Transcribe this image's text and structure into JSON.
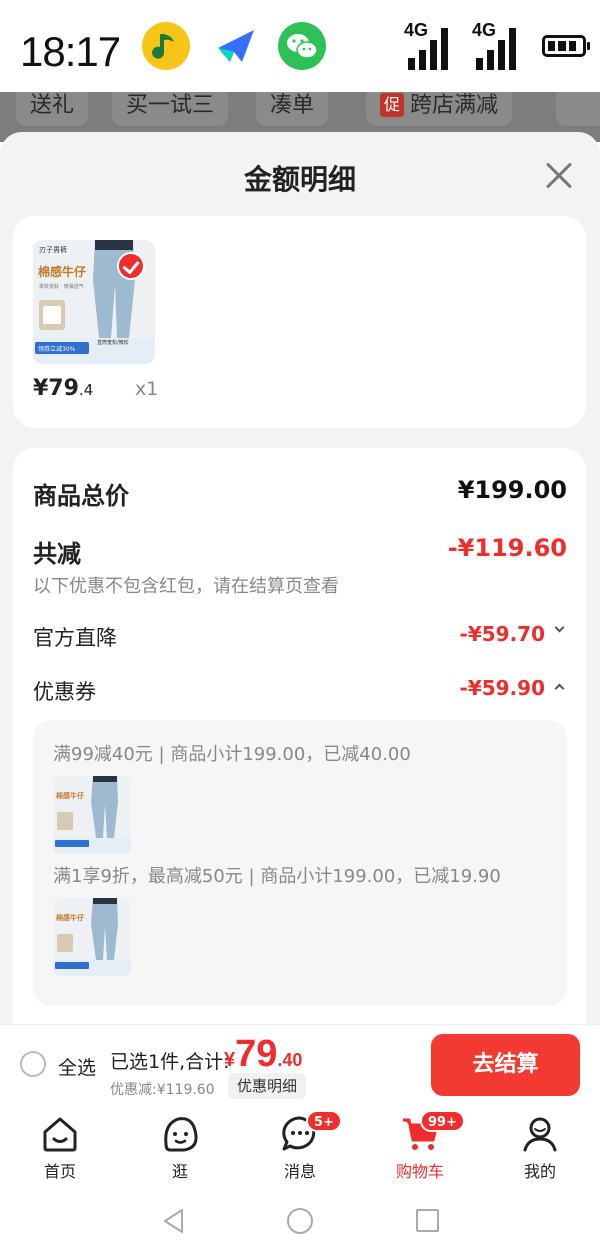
{
  "status_bar": {
    "time": "18:17",
    "network_1": "4G",
    "network_2": "4G",
    "app_icons": [
      "qq-music-icon",
      "feishu-icon",
      "wechat-icon"
    ]
  },
  "background_tabs": [
    "送礼",
    "买一试三",
    "凑单",
    "跨店满减"
  ],
  "background_promo_mark": "促",
  "sheet": {
    "title": "金额明细"
  },
  "product": {
    "price_int": "¥79",
    "price_dec": ".4",
    "quantity": "x1",
    "thumb_text": {
      "brand": "刃子男裤",
      "name": "棉感牛仔",
      "sub": "柔软亲肤 · 微弹透气",
      "promo": "领券立减30%",
      "tag": "直筒宽松/微松"
    }
  },
  "details": {
    "total_label": "商品总价",
    "total_value": "¥199.00",
    "reduce_label": "共减",
    "reduce_value": "-¥119.60",
    "note": "以下优惠不包含红包，请在结算页查看",
    "official_label": "官方直降",
    "official_value": "-¥59.70",
    "coupon_label": "优惠券",
    "coupon_value": "-¥59.90",
    "coupon_lines": [
      "满99减40元 | 商品小计199.00，已减40.00",
      "满1享9折，最高减50元 | 商品小计199.00，已减19.90"
    ]
  },
  "checkout": {
    "select_all": "全选",
    "selected": "已选1件,合计:",
    "currency": "¥",
    "total_int": "79",
    "total_dec": ".40",
    "discount": "优惠减:¥119.60",
    "detail_link": "优惠明细",
    "button": "去结算"
  },
  "tabs": [
    {
      "label": "首页",
      "icon": "home-icon"
    },
    {
      "label": "逛",
      "icon": "browse-icon"
    },
    {
      "label": "消息",
      "icon": "message-icon",
      "badge": "5+"
    },
    {
      "label": "购物车",
      "icon": "cart-icon",
      "badge": "99+",
      "active": true
    },
    {
      "label": "我的",
      "icon": "profile-icon"
    }
  ],
  "colors": {
    "accent_red": "#f02d2d",
    "checkout_button": "#f33a32",
    "sheet_bg": "#f3f3f3"
  }
}
